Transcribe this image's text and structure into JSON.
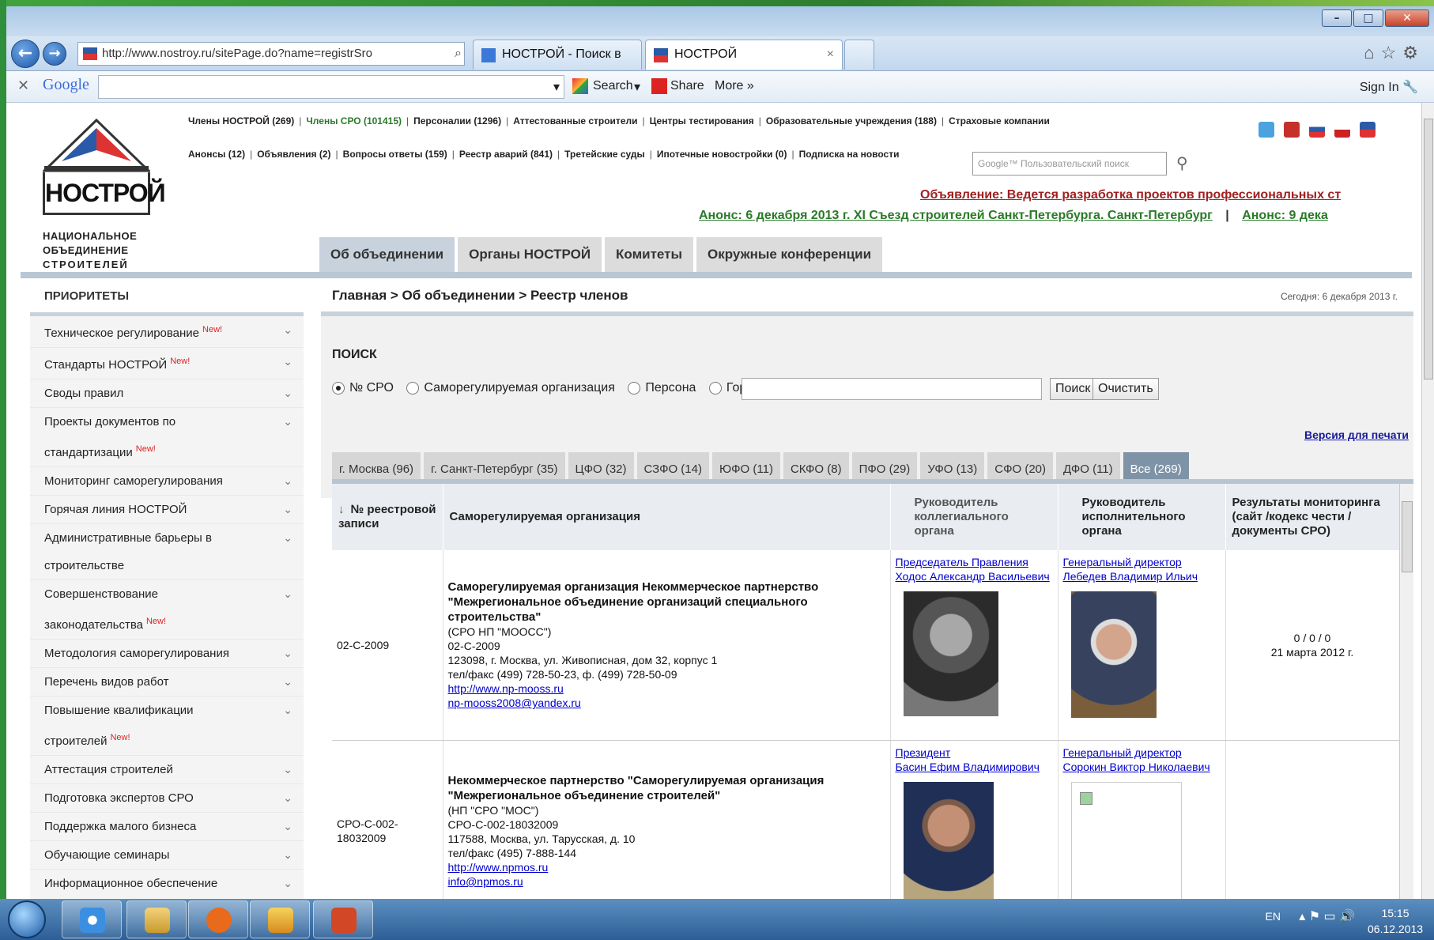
{
  "browser": {
    "address": "http://www.nostroy.ru/sitePage.do?name=registrSro",
    "tabs": [
      {
        "label": "НОСТРОЙ - Поиск в Google"
      },
      {
        "label": "НОСТРОЙ"
      }
    ]
  },
  "googlebar": {
    "logo": "Google",
    "search": "Search",
    "share": "Share",
    "more": "More »",
    "signin": "Sign In"
  },
  "site": {
    "logo_name": "НОСТРОЙ",
    "logo_sub": [
      "НАЦИОНАЛЬНОЕ",
      "ОБЪЕДИНЕНИЕ",
      "СТРОИТЕЛЕЙ"
    ],
    "toplinks_row1": [
      "Члены НОСТРОЙ (269)",
      "Члены СРО (101415)",
      "Персоналии (1296)",
      "Аттестованные строители",
      "Центры тестирования",
      "Образовательные учреждения (188)",
      "Страховые компании"
    ],
    "toplinks_row2": [
      "Анонсы (12)",
      "Объявления (2)",
      "Вопросы ответы (159)",
      "Реестр аварий (841)",
      "Третейские суды",
      "Ипотечные новостройки (0)",
      "Подписка на новости"
    ],
    "gsearch_placeholder": "Google™ Пользовательский поиск",
    "announce_red": "Объявление: Ведется разработка проектов профессиональных ст",
    "announce_green_1": "Анонс: 6 декабря 2013 г.  XI Съезд строителей Санкт-Петербурга.  Санкт-Петербург",
    "announce_green_sep": "|",
    "announce_green_2": "Анонс: 9 дека",
    "mainnav": [
      "Об объединении",
      "Органы НОСТРОЙ",
      "Комитеты",
      "Окружные конференции"
    ]
  },
  "sidebar": {
    "title": "ПРИОРИТЕТЫ",
    "new_label": "New!",
    "items": [
      {
        "label": "Техническое регулирование",
        "new": true
      },
      {
        "label": "Стандарты НОСТРОЙ",
        "new": true
      },
      {
        "label": "Своды правил"
      },
      {
        "label": "Проекты документов по стандартизации",
        "new": true
      },
      {
        "label": "Мониторинг саморегулирования"
      },
      {
        "label": "Горячая линия НОСТРОЙ"
      },
      {
        "label": "Административные барьеры в строительстве"
      },
      {
        "label": "Совершенствование законодательства",
        "new": true
      },
      {
        "label": "Методология саморегулирования"
      },
      {
        "label": "Перечень видов работ"
      },
      {
        "label": "Повышение квалификации строителей",
        "new": true
      },
      {
        "label": "Аттестация строителей"
      },
      {
        "label": "Подготовка экспертов СРО"
      },
      {
        "label": "Поддержка малого бизнеса"
      },
      {
        "label": "Обучающие семинары"
      },
      {
        "label": "Информационное обеспечение саморегулирования"
      }
    ]
  },
  "content": {
    "breadcrumb": "Главная > Об объединении > Реестр членов",
    "today": "Сегодня: 6 декабря 2013 г.",
    "search_title": "ПОИСК",
    "radios": [
      "№ СРО",
      "Саморегулируемая организация",
      "Персона",
      "Город"
    ],
    "search_btn": "Поиск",
    "clear_btn": "Очистить",
    "print_link": "Версия для печати",
    "regions": [
      "г. Москва (96)",
      "г. Санкт-Петербург (35)",
      "ЦФО (32)",
      "СЗФО (14)",
      "ЮФО (11)",
      "СКФО (8)",
      "ПФО (29)",
      "УФО (13)",
      "СФО (20)",
      "ДФО (11)",
      "Все (269)"
    ],
    "table": {
      "sort_arrow": "↓",
      "headers": [
        "№ реестровой записи",
        "Саморегулируемая организация",
        "Руководитель коллегиального органа",
        "Руководитель исполнительного органа",
        "Результаты мониторинга (сайт /кодекс чести / документы СРО)"
      ],
      "rows": [
        {
          "num": "02-С-2009",
          "org_name": "Саморегулируемая организация Некоммерческое партнерство \"Межрегиональное объединение организаций специального строительства\"",
          "org_short": "(СРО НП \"МООСС\")",
          "org_reg": "02-С-2009",
          "org_addr": "123098, г. Москва, ул. Живописная, дом 32, корпус 1",
          "org_phone": "тел/факс (499) 728-50-23, ф. (499) 728-50-09",
          "org_site": "http://www.np-mooss.ru",
          "org_email": "np-mooss2008@yandex.ru",
          "board_role": "Председатель Правления",
          "board_name": "Ходос Александр Васильевич",
          "exec_role": "Генеральный директор",
          "exec_name": "Лебедев Владимир Ильич",
          "monitoring": "0 / 0 / 0",
          "monitoring_date": "21 марта 2012 г."
        },
        {
          "num": "СРО-С-002-18032009",
          "org_name": "Некоммерческое партнерство \"Саморегулируемая организация \"Межрегиональное объединение строителей\"",
          "org_short": "(НП \"СРО \"МОС\")",
          "org_reg": "СРО-С-002-18032009",
          "org_addr": "117588, Москва, ул. Тарусская, д. 10",
          "org_phone": "тел/факс (495) 7-888-144",
          "org_site": "http://www.npmos.ru",
          "org_email": "info@npmos.ru",
          "board_role": "Президент",
          "board_name": "Басин Ефим Владимирович",
          "exec_role": "Генеральный директор",
          "exec_name": "Сорокин Виктор Николаевич",
          "monitoring": "",
          "monitoring_date": ""
        }
      ]
    }
  },
  "taskbar": {
    "lang": "EN",
    "time": "15:15",
    "date": "06.12.2013"
  }
}
